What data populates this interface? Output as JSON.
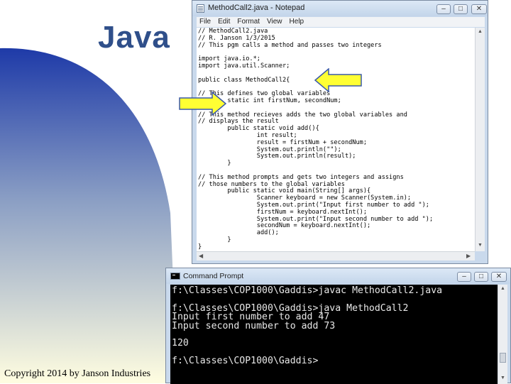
{
  "slide": {
    "title": "Java",
    "copyright": "Copyright 2014 by Janson Industries",
    "colors": {
      "gradient_top": "#1e3aa8",
      "gradient_bottom": "#fffde0",
      "title": "#2f4f8a",
      "arrow_fill": "#ffff33"
    }
  },
  "notepad": {
    "title": "MethodCall2.java - Notepad",
    "menu": [
      "File",
      "Edit",
      "Format",
      "View",
      "Help"
    ],
    "code_lines": [
      "// MethodCall2.java",
      "// R. Janson 1/3/2015",
      "// This pgm calls a method and passes two integers",
      "",
      "import java.io.*;",
      "import java.util.Scanner;",
      "",
      "public class MethodCall2{",
      "",
      "// This defines two global variables",
      "        static int firstNum, secondNum;",
      "",
      "// This method recieves adds the two global variables and",
      "// displays the result",
      "        public static void add(){",
      "                int result;",
      "                result = firstNum + secondNum;",
      "                System.out.println(\"\");",
      "                System.out.println(result);",
      "        }",
      "",
      "// This method prompts and gets two integers and assigns",
      "// those numbers to the global variables",
      "        public static void main(String[] args){",
      "                Scanner keyboard = new Scanner(System.in);",
      "                System.out.print(\"Input first number to add \");",
      "                firstNum = keyboard.nextInt();",
      "                System.out.print(\"Input second number to add \");",
      "                secondNum = keyboard.nextInt();",
      "                add();",
      "        }",
      "}"
    ]
  },
  "cmd": {
    "title": "Command Prompt",
    "lines": [
      "f:\\Classes\\COP1000\\Gaddis>javac MethodCall2.java",
      "",
      "f:\\Classes\\COP1000\\Gaddis>java MethodCall2",
      "Input first number to add 47",
      "Input second number to add 73",
      "",
      "120",
      "",
      "f:\\Classes\\COP1000\\Gaddis>"
    ]
  }
}
